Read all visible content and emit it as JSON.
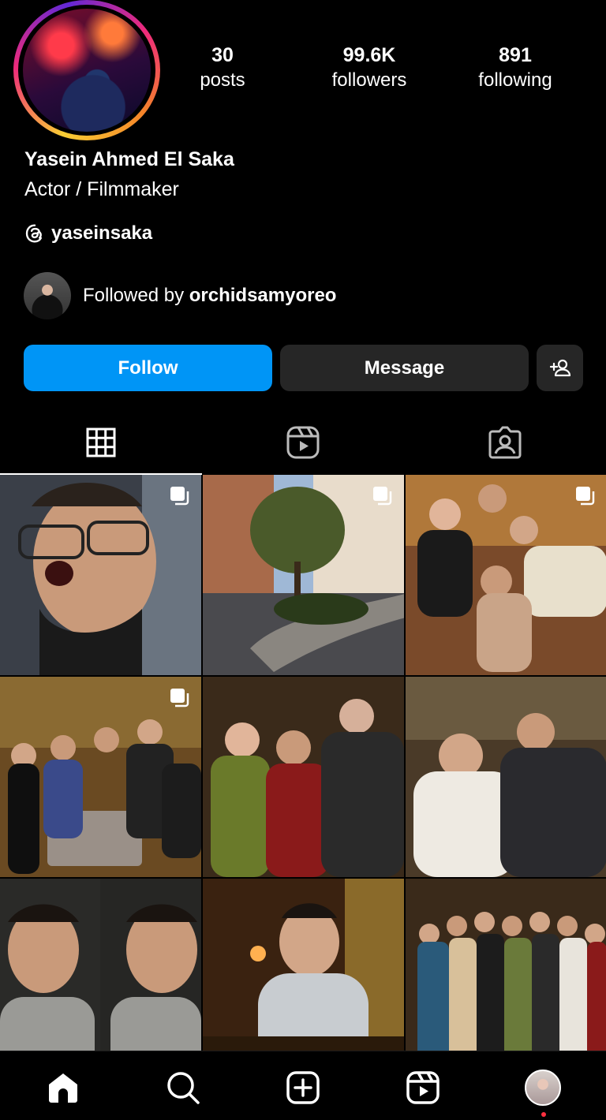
{
  "profile": {
    "name": "Yasein Ahmed El Saka",
    "bio": "Actor / Filmmaker",
    "threads_handle": "yaseinsaka",
    "stats": [
      {
        "num": "30",
        "label": "posts"
      },
      {
        "num": "99.6K",
        "label": "followers"
      },
      {
        "num": "891",
        "label": "following"
      }
    ],
    "followed_by_prefix": "Followed by",
    "followed_by_user": "orchidsamyoreo"
  },
  "actions": {
    "follow_label": "Follow",
    "message_label": "Message"
  },
  "tabs": [
    {
      "name": "posts-grid",
      "icon": "grid-icon",
      "active": true
    },
    {
      "name": "reels",
      "icon": "reels-icon",
      "active": false
    },
    {
      "name": "tagged",
      "icon": "tagged-icon",
      "active": false
    }
  ],
  "posts": [
    {
      "id": "post-1",
      "multi": true
    },
    {
      "id": "post-2",
      "multi": true
    },
    {
      "id": "post-3",
      "multi": true
    },
    {
      "id": "post-4",
      "multi": true
    },
    {
      "id": "post-5",
      "multi": false
    },
    {
      "id": "post-6",
      "multi": false
    },
    {
      "id": "post-7",
      "multi": false
    },
    {
      "id": "post-8",
      "multi": false
    },
    {
      "id": "post-9",
      "multi": false
    }
  ],
  "bottom_nav": [
    "home-icon",
    "search-icon",
    "create-icon",
    "reels-icon",
    "profile-avatar"
  ],
  "colors": {
    "accent": "#0095f6",
    "button_dark": "#262626",
    "background": "#000000"
  }
}
